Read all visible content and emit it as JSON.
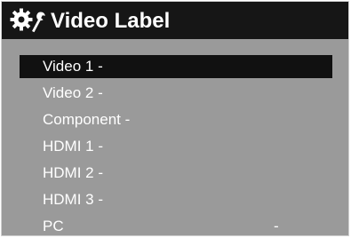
{
  "header": {
    "title": "Video Label",
    "icon": "gear-wrench-icon"
  },
  "menu": {
    "items": [
      {
        "label": "Video 1 -",
        "value": "",
        "selected": true
      },
      {
        "label": "Video 2 -",
        "value": "",
        "selected": false
      },
      {
        "label": "Component -",
        "value": "",
        "selected": false
      },
      {
        "label": "HDMI 1 -",
        "value": "",
        "selected": false
      },
      {
        "label": "HDMI 2 -",
        "value": "",
        "selected": false
      },
      {
        "label": "HDMI 3 -",
        "value": "",
        "selected": false
      },
      {
        "label": "PC",
        "value": "-",
        "selected": false
      }
    ]
  },
  "colors": {
    "title_bar": "#161616",
    "panel": "#9a9a9a",
    "selected_row": "#111111",
    "text": "#ffffff"
  }
}
